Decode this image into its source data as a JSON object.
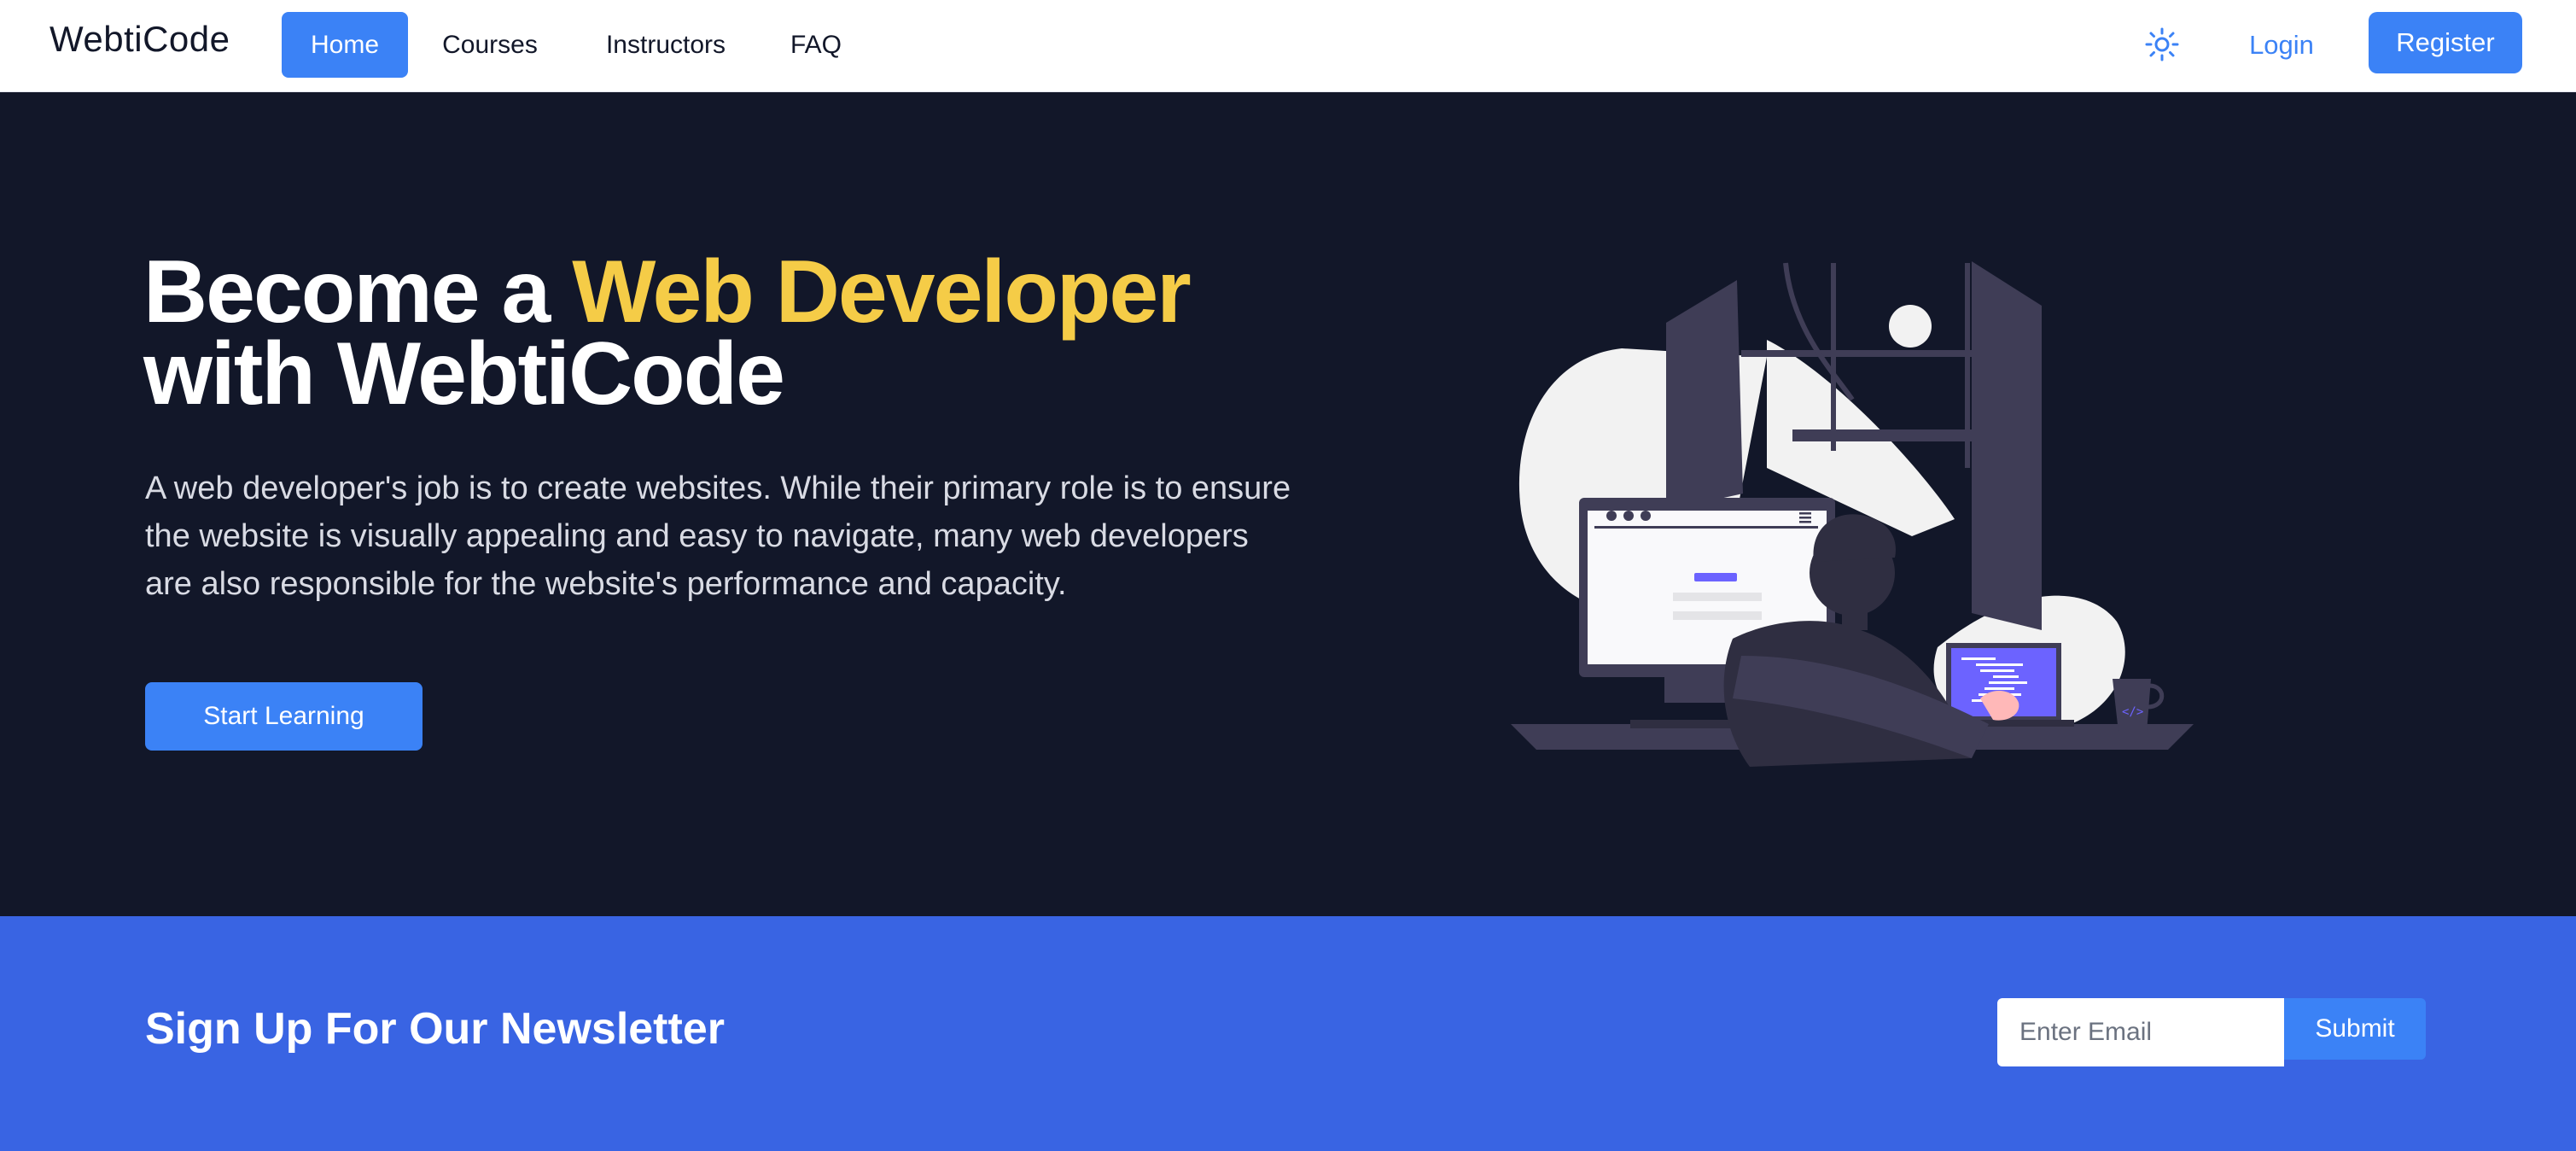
{
  "navbar": {
    "brand": "WebtiCode",
    "links": [
      {
        "label": "Home",
        "active": true
      },
      {
        "label": "Courses",
        "active": false
      },
      {
        "label": "Instructors",
        "active": false
      },
      {
        "label": "FAQ",
        "active": false
      }
    ],
    "theme_icon": "sun-icon",
    "login_label": "Login",
    "register_label": "Register"
  },
  "hero": {
    "title_part1": "Become a ",
    "title_accent": "Web Developer",
    "title_part2": "with WebtiCode",
    "description": "A web developer's job is to create websites. While their primary role is to ensure the website is visually appealing and easy to navigate, many web developers are also responsible for the website's performance and capacity.",
    "cta_label": "Start Learning"
  },
  "newsletter": {
    "title": "Sign Up For Our Newsletter",
    "email_placeholder": "Enter Email",
    "submit_label": "Submit"
  },
  "colors": {
    "primary": "#3b82f6",
    "hero_bg": "#121729",
    "accent": "#f5cc47",
    "newsletter_bg": "#3964e3"
  }
}
